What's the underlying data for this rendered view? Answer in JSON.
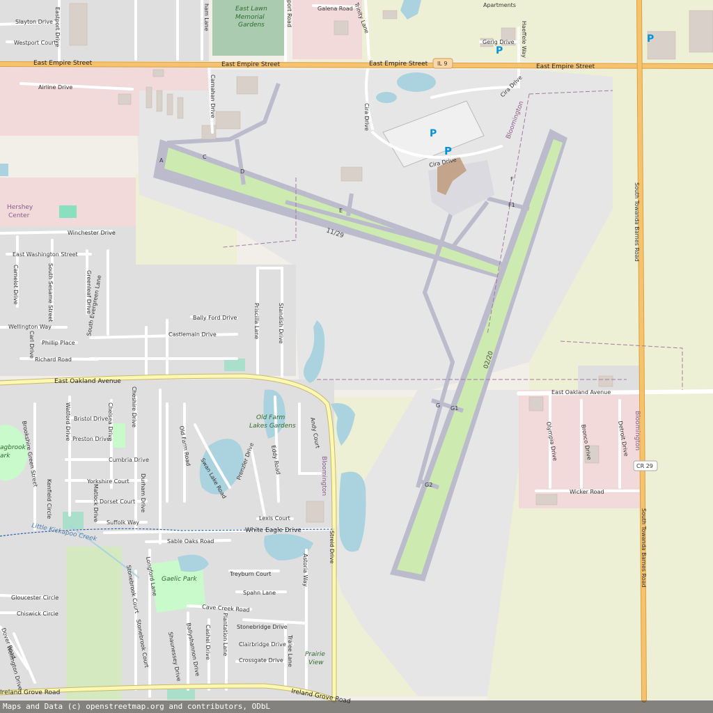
{
  "attribution": "Maps and Data (c) openstreetmap.org and contributors, ODbL",
  "colors": {
    "land": "#f2efe9",
    "farmland": "#eef0d5",
    "residential": "#e0dfdf",
    "retail": "#f2dadb",
    "apron": "#dadae0",
    "runway": "#bbbbcc",
    "grass": "#cdebb0",
    "water": "#aad3df",
    "cemetery": "#aacbaf",
    "major_road": "#f7c26e",
    "road": "#ffffff",
    "park": "#c8facc"
  },
  "icons": [
    "parking-icon-1",
    "parking-icon-2",
    "parking-icon-3",
    "parking-icon-4"
  ],
  "labels": {
    "slayton": "Slayton Drive",
    "westport_ct": "Westport Court",
    "eastport": "Eastport Drive",
    "lawn_garden_1": "East Lawn",
    "lawn_garden_2": "Memorial",
    "lawn_garden_3": "Gardens",
    "galena": "Galena Road",
    "trinity": "Trinity Lane",
    "apartments": "Apartments",
    "gerig": "Gerig Drive",
    "haeffele": "Haeffele Way",
    "empire1": "East Empire Street",
    "empire2": "East Empire Street",
    "empire3": "East Empire Street",
    "empire4": "East Empire Street",
    "il9": "IL 9",
    "airline": "Airline Drive",
    "carnahan": "Carnahan Drive",
    "cira1": "Cira Drive",
    "cira2": "Cira Drive",
    "cira3": "Cira Drive",
    "bloom1": "Bloomington",
    "bloom2": "Bloomington",
    "bloom3": "Bloomington",
    "hershey1": "Hershey",
    "hershey2": "Center",
    "winchester": "Winchester Drive",
    "e_washington": "East Washington Street",
    "camelot": "Camelot Drive",
    "s_sesame": "South Sesame Street",
    "greenleaf": "Greenleaf Drive",
    "evergreen": "South Evergreen Lane",
    "wellington": "Wellington Way",
    "phillip": "Phillip Place",
    "carl": "Carl Drive",
    "richard": "Richard Road",
    "bally_ford": "Bally Ford Drive",
    "castlemain": "Castlemain Drive",
    "priscilla": "Priscilla Lane",
    "standish": "Standish Drive",
    "oakland1": "East Oakland Avenue",
    "oakland2": "East Oakland Avenue",
    "towanda1": "South Towanda Barnes Road",
    "towanda2": "South Towanda Barnes Road",
    "cr29": "CR 29",
    "rwy_1129": "11/29",
    "rwy_0220": "02/20",
    "tw_a": "A",
    "tw_c": "C",
    "tw_d": "D",
    "tw_e": "E",
    "tw_f": "F",
    "tw_f1": "F1",
    "tw_g": "G",
    "tw_g1": "G1",
    "tw_g2": "G2",
    "bristol": "Bristol Drive",
    "preston": "Preston Drive",
    "watford": "Watford Drive",
    "chelsea": "Chelsea Drive",
    "cheshire": "Cheshire Drive",
    "cumbria": "Cumbria Drive",
    "yorkshire": "Yorkshire Court",
    "dorset": "Dorset Court",
    "suffolk": "Suffolk Way",
    "durham": "Durham Drive",
    "matlock": "Matlock Drive",
    "kenfield": "Kenfield Circle",
    "brookshire": "Brookshire Green Street",
    "old_farm_rd": "Old Farm Road",
    "swan_lake": "Swan Lake Road",
    "old_farm_1": "Old Farm",
    "old_farm_2": "Lakes Gardens",
    "andy": "Andy Court",
    "eddy": "Eddy Road",
    "prenzler": "Prenzler Drive",
    "lexis": "Lexis Court",
    "olympia": "Olympia Drive",
    "bronco": "Bronco Drive",
    "detroit": "Detroit Drive",
    "wicker": "Wicker Road",
    "ruffbrook_1": "agbrook",
    "ruffbrook_2": "ark",
    "kickapoo": "Little Kickapoo Creek",
    "white_eagle": "White Eagle Drive",
    "sable_oaks": "Sable Oaks Road",
    "streid": "Streid Drive",
    "longford": "Longford Lane",
    "stonebrook_ct": "Stonebrook Court",
    "stonebrook_ct2": "Stonebrook Court",
    "gaelic": "Gaelic Park",
    "treyburn": "Treyburn Court",
    "spahn": "Spahn Lane",
    "astoria": "Astoria Way",
    "cave_creek": "Cave Creek Road",
    "cashel": "Cashel Drive",
    "stonebridge": "Stonebridge Drive",
    "plantation": "Plantation Lane",
    "clairbridge": "Clairbridge Drive",
    "tralee": "Tralee Lane",
    "crossgate": "Crossgate Drive",
    "shaunessey": "Shaunessey Drive",
    "ballyshannon": "Ballyshannon Drive",
    "gloucester": "Gloucester Circle",
    "chiswick": "Chiswick Circle",
    "dover": "Dover Road",
    "wellington_dr": "Wellington Drive",
    "prairie_1": "Prairie",
    "prairie_2": "View",
    "ireland1": "Ireland Grove Road",
    "ireland2": "Ireland Grove Road",
    "hamlane": "ham Lane",
    "eastport_rd": "port Road"
  }
}
